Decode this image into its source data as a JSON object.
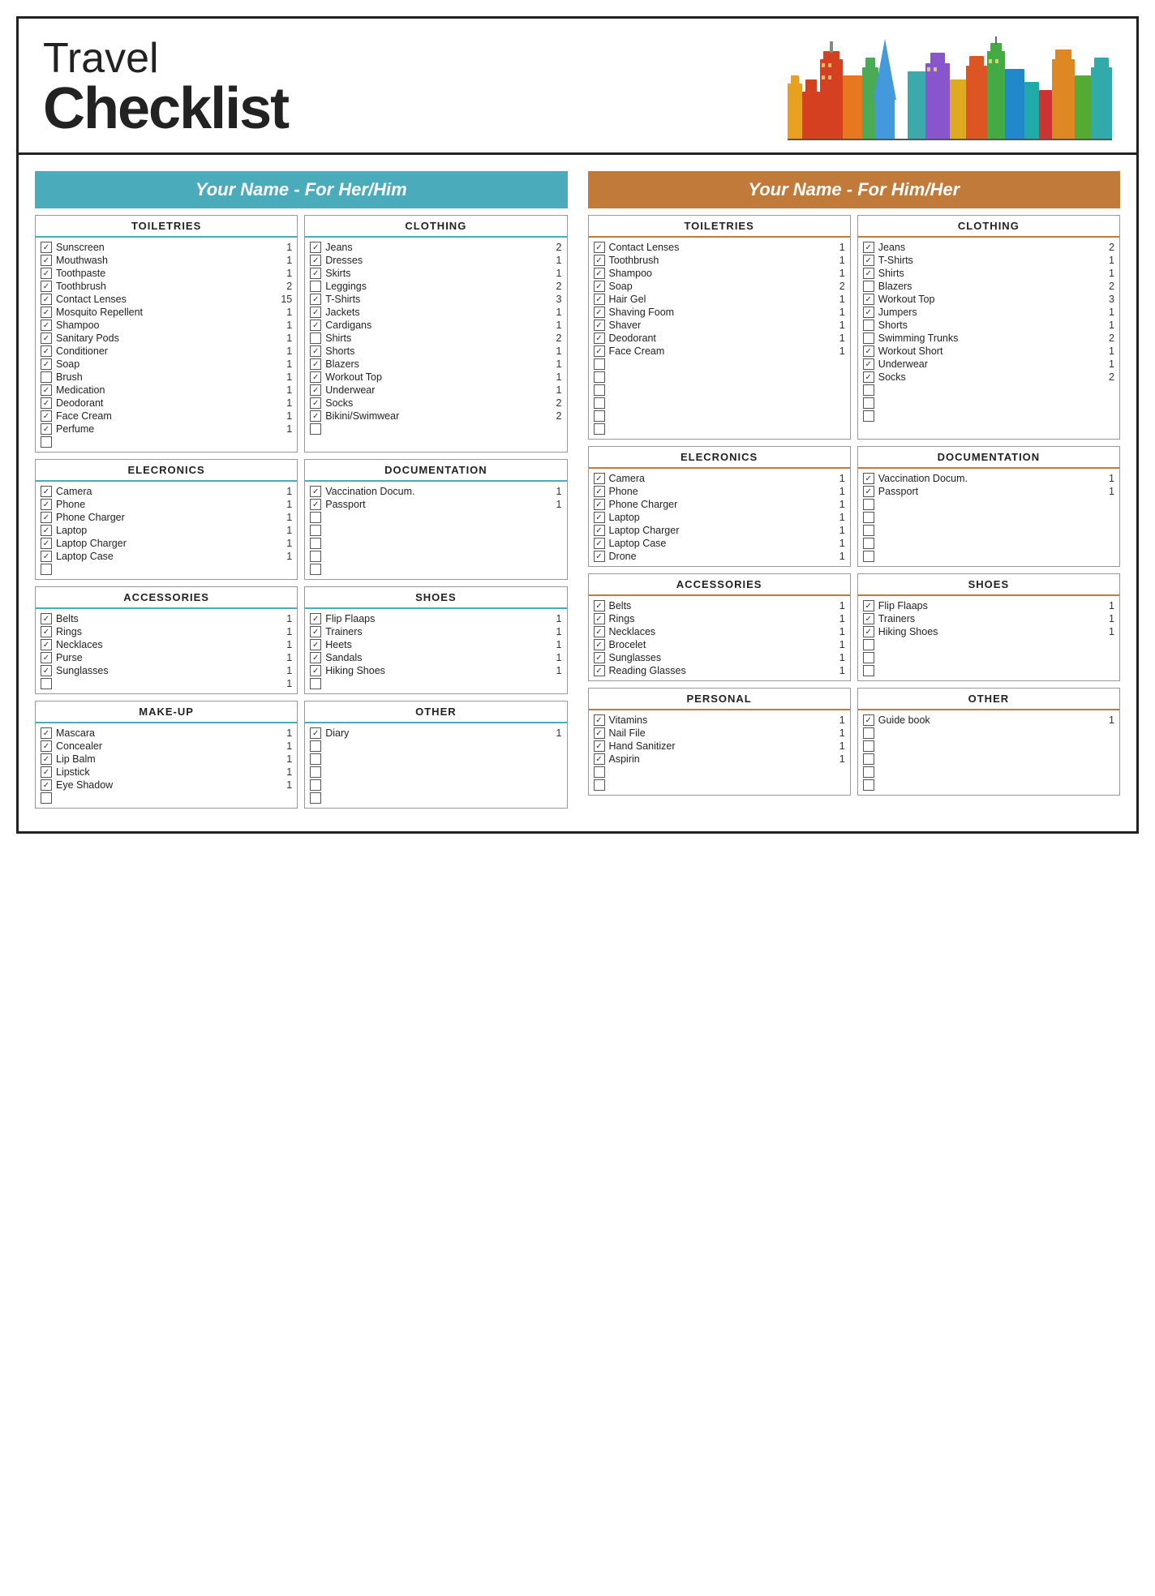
{
  "header": {
    "travel": "Travel",
    "checklist": "Checklist"
  },
  "her": {
    "banner": "Your Name - For Her/Him",
    "toiletries": {
      "title": "TOILETRIES",
      "items": [
        {
          "checked": true,
          "name": "Sunscreen",
          "qty": "1"
        },
        {
          "checked": true,
          "name": "Mouthwash",
          "qty": "1"
        },
        {
          "checked": true,
          "name": "Toothpaste",
          "qty": "1"
        },
        {
          "checked": true,
          "name": "Toothbrush",
          "qty": "2"
        },
        {
          "checked": true,
          "name": "Contact Lenses",
          "qty": "15"
        },
        {
          "checked": true,
          "name": "Mosquito Repellent",
          "qty": "1"
        },
        {
          "checked": true,
          "name": "Shampoo",
          "qty": "1"
        },
        {
          "checked": true,
          "name": "Sanitary Pods",
          "qty": "1"
        },
        {
          "checked": true,
          "name": "Conditioner",
          "qty": "1"
        },
        {
          "checked": true,
          "name": "Soap",
          "qty": "1"
        },
        {
          "checked": false,
          "name": "Brush",
          "qty": "1"
        },
        {
          "checked": true,
          "name": "Medication",
          "qty": "1"
        },
        {
          "checked": true,
          "name": "Deodorant",
          "qty": "1"
        },
        {
          "checked": true,
          "name": "Face Cream",
          "qty": "1"
        },
        {
          "checked": true,
          "name": "Perfume",
          "qty": "1"
        },
        {
          "checked": false,
          "name": "",
          "qty": ""
        }
      ]
    },
    "clothing": {
      "title": "CLOTHING",
      "items": [
        {
          "checked": true,
          "name": "Jeans",
          "qty": "2"
        },
        {
          "checked": true,
          "name": "Dresses",
          "qty": "1"
        },
        {
          "checked": true,
          "name": "Skirts",
          "qty": "1"
        },
        {
          "checked": false,
          "name": "Leggings",
          "qty": "2"
        },
        {
          "checked": true,
          "name": "T-Shirts",
          "qty": "3"
        },
        {
          "checked": true,
          "name": "Jackets",
          "qty": "1"
        },
        {
          "checked": true,
          "name": "Cardigans",
          "qty": "1"
        },
        {
          "checked": false,
          "name": "Shirts",
          "qty": "2"
        },
        {
          "checked": true,
          "name": "Shorts",
          "qty": "1"
        },
        {
          "checked": true,
          "name": "Blazers",
          "qty": "1"
        },
        {
          "checked": true,
          "name": "Workout Top",
          "qty": "1"
        },
        {
          "checked": true,
          "name": "Underwear",
          "qty": "1"
        },
        {
          "checked": true,
          "name": "Socks",
          "qty": "2"
        },
        {
          "checked": true,
          "name": "Bikini/Swimwear",
          "qty": "2"
        },
        {
          "checked": false,
          "name": "",
          "qty": ""
        }
      ]
    },
    "electronics": {
      "title": "ELECRONICS",
      "items": [
        {
          "checked": true,
          "name": "Camera",
          "qty": "1"
        },
        {
          "checked": true,
          "name": "Phone",
          "qty": "1"
        },
        {
          "checked": true,
          "name": "Phone Charger",
          "qty": "1"
        },
        {
          "checked": true,
          "name": "Laptop",
          "qty": "1"
        },
        {
          "checked": true,
          "name": "Laptop Charger",
          "qty": "1"
        },
        {
          "checked": true,
          "name": "Laptop Case",
          "qty": "1"
        },
        {
          "checked": false,
          "name": "",
          "qty": ""
        }
      ]
    },
    "documentation": {
      "title": "DOCUMENTATION",
      "items": [
        {
          "checked": true,
          "name": "Vaccination Docum.",
          "qty": "1"
        },
        {
          "checked": true,
          "name": "Passport",
          "qty": "1"
        },
        {
          "checked": false,
          "name": "",
          "qty": ""
        },
        {
          "checked": false,
          "name": "",
          "qty": ""
        },
        {
          "checked": false,
          "name": "",
          "qty": ""
        },
        {
          "checked": false,
          "name": "",
          "qty": ""
        },
        {
          "checked": false,
          "name": "",
          "qty": ""
        }
      ]
    },
    "accessories": {
      "title": "ACCESSORIES",
      "items": [
        {
          "checked": true,
          "name": "Belts",
          "qty": "1"
        },
        {
          "checked": true,
          "name": "Rings",
          "qty": "1"
        },
        {
          "checked": true,
          "name": "Necklaces",
          "qty": "1"
        },
        {
          "checked": true,
          "name": "Purse",
          "qty": "1"
        },
        {
          "checked": true,
          "name": "Sunglasses",
          "qty": "1"
        },
        {
          "checked": false,
          "name": "",
          "qty": "1"
        }
      ]
    },
    "shoes": {
      "title": "SHOES",
      "items": [
        {
          "checked": true,
          "name": "Flip Flaaps",
          "qty": "1"
        },
        {
          "checked": true,
          "name": "Trainers",
          "qty": "1"
        },
        {
          "checked": true,
          "name": "Heets",
          "qty": "1"
        },
        {
          "checked": true,
          "name": "Sandals",
          "qty": "1"
        },
        {
          "checked": true,
          "name": "Hiking Shoes",
          "qty": "1"
        },
        {
          "checked": false,
          "name": "",
          "qty": ""
        }
      ]
    },
    "makeup": {
      "title": "MAKE-UP",
      "items": [
        {
          "checked": true,
          "name": "Mascara",
          "qty": "1"
        },
        {
          "checked": true,
          "name": "Concealer",
          "qty": "1"
        },
        {
          "checked": true,
          "name": "Lip Balm",
          "qty": "1"
        },
        {
          "checked": true,
          "name": "Lipstick",
          "qty": "1"
        },
        {
          "checked": true,
          "name": "Eye Shadow",
          "qty": "1"
        },
        {
          "checked": false,
          "name": "",
          "qty": ""
        }
      ]
    },
    "other": {
      "title": "OTHER",
      "items": [
        {
          "checked": true,
          "name": "Diary",
          "qty": "1"
        },
        {
          "checked": false,
          "name": "",
          "qty": ""
        },
        {
          "checked": false,
          "name": "",
          "qty": ""
        },
        {
          "checked": false,
          "name": "",
          "qty": ""
        },
        {
          "checked": false,
          "name": "",
          "qty": ""
        },
        {
          "checked": false,
          "name": "",
          "qty": ""
        }
      ]
    }
  },
  "him": {
    "banner": "Your Name - For Him/Her",
    "toiletries": {
      "title": "TOILETRIES",
      "items": [
        {
          "checked": true,
          "name": "Contact Lenses",
          "qty": "1"
        },
        {
          "checked": true,
          "name": "Toothbrush",
          "qty": "1"
        },
        {
          "checked": true,
          "name": "Shampoo",
          "qty": "1"
        },
        {
          "checked": true,
          "name": "Soap",
          "qty": "2"
        },
        {
          "checked": true,
          "name": "Hair Gel",
          "qty": "1"
        },
        {
          "checked": true,
          "name": "Shaving Foom",
          "qty": "1"
        },
        {
          "checked": true,
          "name": "Shaver",
          "qty": "1"
        },
        {
          "checked": true,
          "name": "Deodorant",
          "qty": "1"
        },
        {
          "checked": true,
          "name": "Face Cream",
          "qty": "1"
        },
        {
          "checked": false,
          "name": "",
          "qty": ""
        },
        {
          "checked": false,
          "name": "",
          "qty": ""
        },
        {
          "checked": false,
          "name": "",
          "qty": ""
        },
        {
          "checked": false,
          "name": "",
          "qty": ""
        },
        {
          "checked": false,
          "name": "",
          "qty": ""
        },
        {
          "checked": false,
          "name": "",
          "qty": ""
        }
      ]
    },
    "clothing": {
      "title": "CLOTHING",
      "items": [
        {
          "checked": true,
          "name": "Jeans",
          "qty": "2"
        },
        {
          "checked": true,
          "name": "T-Shirts",
          "qty": "1"
        },
        {
          "checked": true,
          "name": "Shirts",
          "qty": "1"
        },
        {
          "checked": false,
          "name": "Blazers",
          "qty": "2"
        },
        {
          "checked": true,
          "name": "Workout Top",
          "qty": "3"
        },
        {
          "checked": true,
          "name": "Jumpers",
          "qty": "1"
        },
        {
          "checked": false,
          "name": "Shorts",
          "qty": "1"
        },
        {
          "checked": false,
          "name": "Swimming Trunks",
          "qty": "2"
        },
        {
          "checked": true,
          "name": "Workout Short",
          "qty": "1"
        },
        {
          "checked": true,
          "name": "Underwear",
          "qty": "1"
        },
        {
          "checked": true,
          "name": "Socks",
          "qty": "2"
        },
        {
          "checked": false,
          "name": "",
          "qty": ""
        },
        {
          "checked": false,
          "name": "",
          "qty": ""
        },
        {
          "checked": false,
          "name": "",
          "qty": ""
        }
      ]
    },
    "electronics": {
      "title": "ELECRONICS",
      "items": [
        {
          "checked": true,
          "name": "Camera",
          "qty": "1"
        },
        {
          "checked": true,
          "name": "Phone",
          "qty": "1"
        },
        {
          "checked": true,
          "name": "Phone Charger",
          "qty": "1"
        },
        {
          "checked": true,
          "name": "Laptop",
          "qty": "1"
        },
        {
          "checked": true,
          "name": "Laptop Charger",
          "qty": "1"
        },
        {
          "checked": true,
          "name": "Laptop Case",
          "qty": "1"
        },
        {
          "checked": true,
          "name": "Drone",
          "qty": "1"
        }
      ]
    },
    "documentation": {
      "title": "DOCUMENTATION",
      "items": [
        {
          "checked": true,
          "name": "Vaccination Docum.",
          "qty": "1"
        },
        {
          "checked": true,
          "name": "Passport",
          "qty": "1"
        },
        {
          "checked": false,
          "name": "",
          "qty": ""
        },
        {
          "checked": false,
          "name": "",
          "qty": ""
        },
        {
          "checked": false,
          "name": "",
          "qty": ""
        },
        {
          "checked": false,
          "name": "",
          "qty": ""
        },
        {
          "checked": false,
          "name": "",
          "qty": ""
        }
      ]
    },
    "accessories": {
      "title": "ACCESSORIES",
      "items": [
        {
          "checked": true,
          "name": "Belts",
          "qty": "1"
        },
        {
          "checked": true,
          "name": "Rings",
          "qty": "1"
        },
        {
          "checked": true,
          "name": "Necklaces",
          "qty": "1"
        },
        {
          "checked": true,
          "name": "Brocelet",
          "qty": "1"
        },
        {
          "checked": true,
          "name": "Sunglasses",
          "qty": "1"
        },
        {
          "checked": true,
          "name": "Reading Glasses",
          "qty": "1"
        }
      ]
    },
    "shoes": {
      "title": "SHOES",
      "items": [
        {
          "checked": true,
          "name": "Flip Flaaps",
          "qty": "1"
        },
        {
          "checked": true,
          "name": "Trainers",
          "qty": "1"
        },
        {
          "checked": true,
          "name": "Hiking Shoes",
          "qty": "1"
        },
        {
          "checked": false,
          "name": "",
          "qty": ""
        },
        {
          "checked": false,
          "name": "",
          "qty": ""
        },
        {
          "checked": false,
          "name": "",
          "qty": ""
        }
      ]
    },
    "personal": {
      "title": "PERSONAL",
      "items": [
        {
          "checked": true,
          "name": "Vitamins",
          "qty": "1"
        },
        {
          "checked": true,
          "name": "Nail File",
          "qty": "1"
        },
        {
          "checked": true,
          "name": "Hand Sanitizer",
          "qty": "1"
        },
        {
          "checked": true,
          "name": "Aspirin",
          "qty": "1"
        },
        {
          "checked": false,
          "name": "",
          "qty": ""
        },
        {
          "checked": false,
          "name": "",
          "qty": ""
        }
      ]
    },
    "other": {
      "title": "OTHER",
      "items": [
        {
          "checked": true,
          "name": "Guide book",
          "qty": "1"
        },
        {
          "checked": false,
          "name": "",
          "qty": ""
        },
        {
          "checked": false,
          "name": "",
          "qty": ""
        },
        {
          "checked": false,
          "name": "",
          "qty": ""
        },
        {
          "checked": false,
          "name": "",
          "qty": ""
        },
        {
          "checked": false,
          "name": "",
          "qty": ""
        }
      ]
    }
  }
}
